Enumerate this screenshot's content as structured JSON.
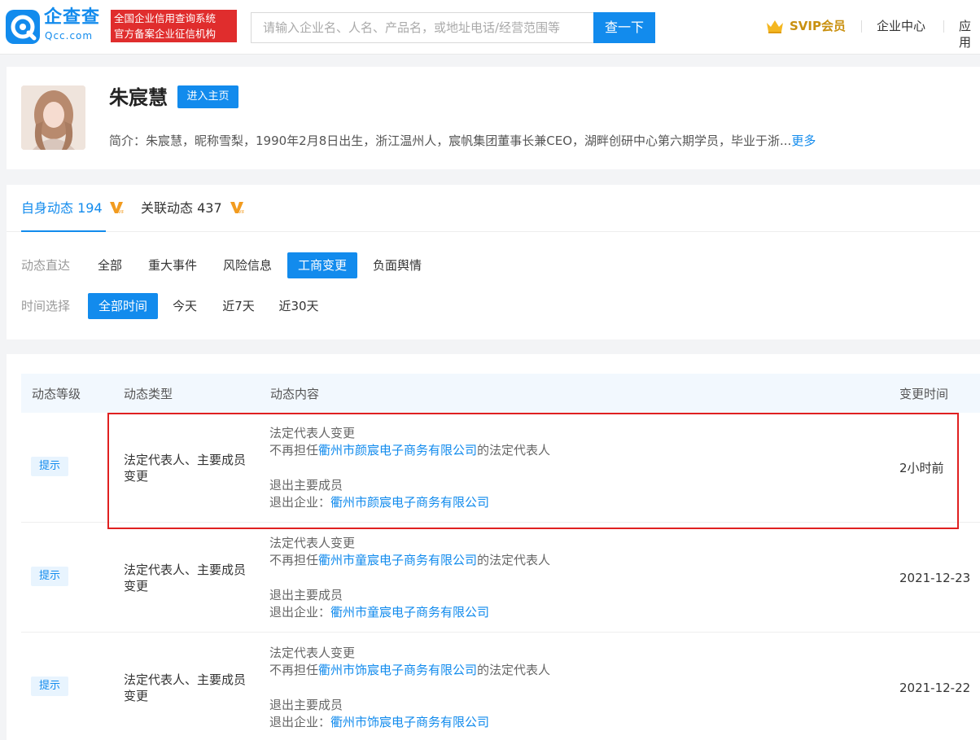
{
  "header": {
    "logo_text": "企查查",
    "logo_sub": "Qcc.com",
    "slogan_line1": "全国企业信用查询系统",
    "slogan_line2": "官方备案企业征信机构",
    "search_placeholder": "请输入企业名、人名、产品名，或地址电话/经营范围等",
    "search_button": "查一下",
    "svip_label": "SVIP会员",
    "links": [
      "企业中心",
      "应用"
    ]
  },
  "profile": {
    "name": "朱宸慧",
    "home_button": "进入主页",
    "intro": "简介：朱宸慧，昵称雪梨，1990年2月8日出生，浙江温州人，宸帆集团董事长兼CEO，湖畔创研中心第六期学员，毕业于浙...",
    "more": "更多"
  },
  "tabs": [
    {
      "label": "自身动态 194",
      "active": true
    },
    {
      "label": "关联动态 437",
      "active": false
    }
  ],
  "filters": {
    "event_label": "动态直达",
    "event_options": [
      "全部",
      "重大事件",
      "风险信息",
      "工商变更",
      "负面舆情"
    ],
    "event_selected": "工商变更",
    "time_label": "时间选择",
    "time_options": [
      "全部时间",
      "今天",
      "近7天",
      "近30天"
    ],
    "time_selected": "全部时间"
  },
  "table": {
    "columns": [
      "动态等级",
      "动态类型",
      "动态内容",
      "变更时间"
    ],
    "rows": [
      {
        "level": "提示",
        "type_line1": "法定代表人、主要成员",
        "type_line2": "变更",
        "c1_title": "法定代表人变更",
        "c1_prefix": "不再担任",
        "c1_company": "衢州市颜宸电子商务有限公司",
        "c1_suffix": "的法定代表人",
        "c2_title": "退出主要成员",
        "c2_prefix": "退出企业：",
        "c2_company": "衢州市颜宸电子商务有限公司",
        "time": "2小时前"
      },
      {
        "level": "提示",
        "type_line1": "法定代表人、主要成员",
        "type_line2": "变更",
        "c1_title": "法定代表人变更",
        "c1_prefix": "不再担任",
        "c1_company": "衢州市童宸电子商务有限公司",
        "c1_suffix": "的法定代表人",
        "c2_title": "退出主要成员",
        "c2_prefix": "退出企业：",
        "c2_company": "衢州市童宸电子商务有限公司",
        "time": "2021-12-23"
      },
      {
        "level": "提示",
        "type_line1": "法定代表人、主要成员",
        "type_line2": "变更",
        "c1_title": "法定代表人变更",
        "c1_prefix": "不再担任",
        "c1_company": "衢州市饰宸电子商务有限公司",
        "c1_suffix": "的法定代表人",
        "c2_title": "退出主要成员",
        "c2_prefix": "退出企业：",
        "c2_company": "衢州市饰宸电子商务有限公司",
        "time": "2021-12-22"
      }
    ]
  },
  "colors": {
    "brand": "#128bed",
    "slogan_bg": "#e02d2d",
    "svip": "#c9900f",
    "highlight_border": "#e02020"
  }
}
